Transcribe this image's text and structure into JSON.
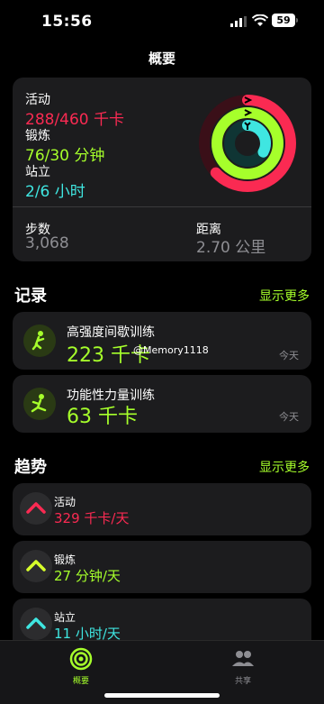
{
  "status": {
    "time": "15:56",
    "battery": "59"
  },
  "nav": {
    "title": "概要"
  },
  "summary": {
    "move_label": "活动",
    "move_value": "288/460 千卡",
    "exercise_label": "锻炼",
    "exercise_value": "76/30 分钟",
    "stand_label": "站立",
    "stand_value": "2/6 小时",
    "steps_label": "步数",
    "steps_value": "3,068",
    "distance_label": "距离",
    "distance_value": "2.70 公里"
  },
  "rings": {
    "move_progress": 0.63,
    "exercise_progress": 1.0,
    "stand_progress": 0.33,
    "colors": {
      "move": "#fa2a52",
      "exercise": "#a6ff2b",
      "stand": "#3fe6e1"
    }
  },
  "records": {
    "title": "记录",
    "more": "显示更多",
    "items": [
      {
        "title": "高强度间歇训练",
        "value": "223 千卡",
        "date": "今天"
      },
      {
        "title": "功能性力量训练",
        "value": "63 千卡",
        "date": "今天"
      }
    ]
  },
  "watermark": "@Memory1118",
  "trends": {
    "title": "趋势",
    "more": "显示更多",
    "items": [
      {
        "title": "活动",
        "value": "329 千卡/天"
      },
      {
        "title": "锻炼",
        "value": "27 分钟/天"
      },
      {
        "title": "站立",
        "value": "11 小时/天"
      }
    ]
  },
  "tabs": [
    {
      "label": "概要"
    },
    {
      "label": "共享"
    }
  ]
}
